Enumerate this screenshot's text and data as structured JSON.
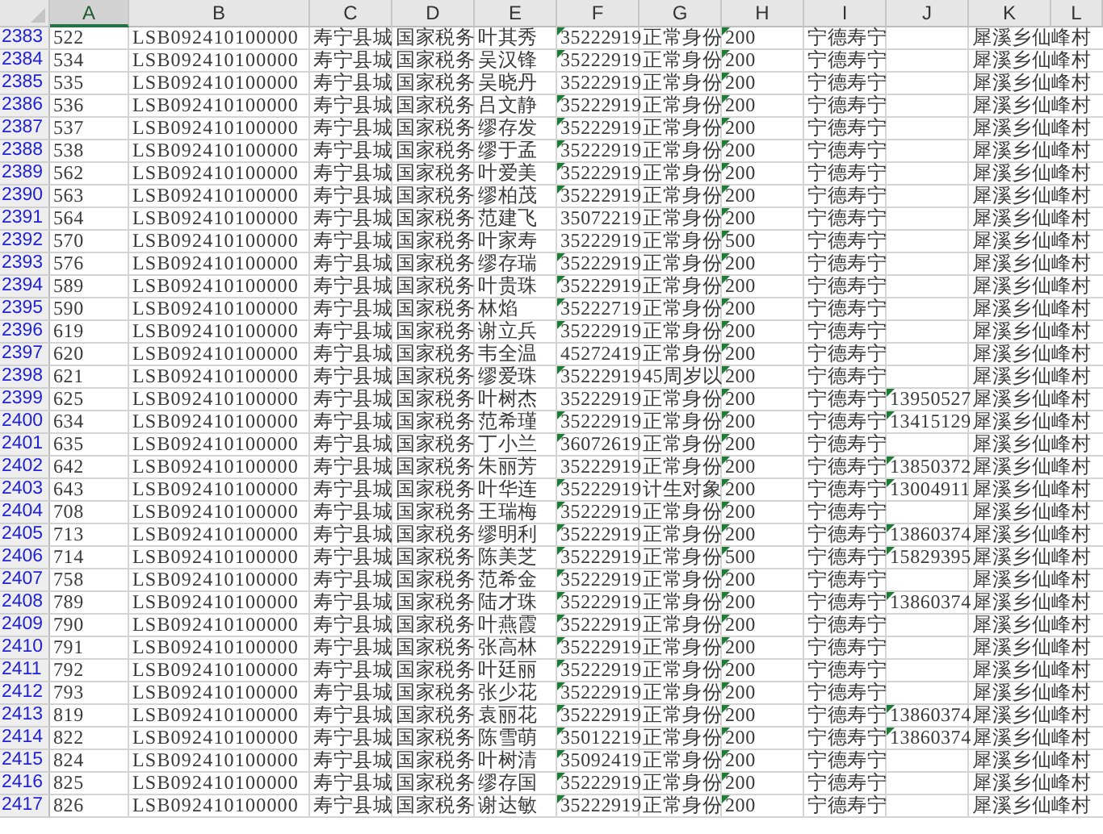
{
  "columns": [
    {
      "label": "A",
      "selected": true
    },
    {
      "label": "B",
      "selected": false
    },
    {
      "label": "C",
      "selected": false
    },
    {
      "label": "D",
      "selected": false
    },
    {
      "label": "E",
      "selected": false
    },
    {
      "label": "F",
      "selected": false
    },
    {
      "label": "G",
      "selected": false
    },
    {
      "label": "H",
      "selected": false
    },
    {
      "label": "I",
      "selected": false
    },
    {
      "label": "J",
      "selected": false
    },
    {
      "label": "K",
      "selected": false
    },
    {
      "label": "L",
      "selected": false
    }
  ],
  "rows": [
    {
      "row": "2383",
      "cells": [
        "522",
        "LSB092410100000",
        "寿宁县城",
        "国家税务",
        "叶其秀",
        "35222919",
        "正常身份",
        "200",
        "宁德寿宁",
        null,
        "犀溪乡仙峰村"
      ],
      "errors": [
        false,
        false,
        false,
        false,
        false,
        true,
        false,
        true,
        false,
        false,
        false
      ]
    },
    {
      "row": "2384",
      "cells": [
        "534",
        "LSB092410100000",
        "寿宁县城",
        "国家税务",
        "吴汉锋",
        "35222919",
        "正常身份",
        "200",
        "宁德寿宁",
        null,
        "犀溪乡仙峰村"
      ],
      "errors": [
        false,
        false,
        false,
        false,
        false,
        true,
        false,
        true,
        false,
        false,
        false
      ]
    },
    {
      "row": "2385",
      "cells": [
        "535",
        "LSB092410100000",
        "寿宁县城",
        "国家税务",
        "吴晓丹",
        "35222919",
        "正常身份",
        "200",
        "宁德寿宁",
        null,
        "犀溪乡仙峰村"
      ],
      "errors": [
        false,
        false,
        false,
        false,
        false,
        false,
        false,
        true,
        false,
        false,
        false
      ]
    },
    {
      "row": "2386",
      "cells": [
        "536",
        "LSB092410100000",
        "寿宁县城",
        "国家税务",
        "吕文静",
        "35222919",
        "正常身份",
        "200",
        "宁德寿宁",
        null,
        "犀溪乡仙峰村"
      ],
      "errors": [
        false,
        false,
        false,
        false,
        false,
        true,
        false,
        true,
        false,
        false,
        false
      ]
    },
    {
      "row": "2387",
      "cells": [
        "537",
        "LSB092410100000",
        "寿宁县城",
        "国家税务",
        "缪存发",
        "35222919",
        "正常身份",
        "200",
        "宁德寿宁",
        null,
        "犀溪乡仙峰村"
      ],
      "errors": [
        false,
        false,
        false,
        false,
        false,
        true,
        false,
        true,
        false,
        false,
        false
      ]
    },
    {
      "row": "2388",
      "cells": [
        "538",
        "LSB092410100000",
        "寿宁县城",
        "国家税务",
        "缪于孟",
        "35222919",
        "正常身份",
        "200",
        "宁德寿宁",
        null,
        "犀溪乡仙峰村"
      ],
      "errors": [
        false,
        false,
        false,
        false,
        false,
        true,
        false,
        true,
        false,
        false,
        false
      ]
    },
    {
      "row": "2389",
      "cells": [
        "562",
        "LSB092410100000",
        "寿宁县城",
        "国家税务",
        "叶爱美",
        "35222919",
        "正常身份",
        "200",
        "宁德寿宁",
        null,
        "犀溪乡仙峰村"
      ],
      "errors": [
        false,
        false,
        false,
        false,
        false,
        true,
        false,
        true,
        false,
        false,
        false
      ]
    },
    {
      "row": "2390",
      "cells": [
        "563",
        "LSB092410100000",
        "寿宁县城",
        "国家税务",
        "缪柏茂",
        "35222919",
        "正常身份",
        "200",
        "宁德寿宁",
        null,
        "犀溪乡仙峰村"
      ],
      "errors": [
        false,
        false,
        false,
        false,
        false,
        true,
        false,
        true,
        false,
        false,
        false
      ]
    },
    {
      "row": "2391",
      "cells": [
        "564",
        "LSB092410100000",
        "寿宁县城",
        "国家税务",
        "范建飞",
        "35072219",
        "正常身份",
        "200",
        "宁德寿宁",
        null,
        "犀溪乡仙峰村"
      ],
      "errors": [
        false,
        false,
        false,
        false,
        false,
        false,
        false,
        true,
        false,
        false,
        false
      ]
    },
    {
      "row": "2392",
      "cells": [
        "570",
        "LSB092410100000",
        "寿宁县城",
        "国家税务",
        "叶家寿",
        "35222919",
        "正常身份",
        "500",
        "宁德寿宁",
        null,
        "犀溪乡仙峰村"
      ],
      "errors": [
        false,
        false,
        false,
        false,
        false,
        false,
        false,
        true,
        false,
        false,
        false
      ]
    },
    {
      "row": "2393",
      "cells": [
        "576",
        "LSB092410100000",
        "寿宁县城",
        "国家税务",
        "缪存瑞",
        "35222919",
        "正常身份",
        "200",
        "宁德寿宁",
        null,
        "犀溪乡仙峰村"
      ],
      "errors": [
        false,
        false,
        false,
        false,
        false,
        true,
        false,
        true,
        false,
        false,
        false
      ]
    },
    {
      "row": "2394",
      "cells": [
        "589",
        "LSB092410100000",
        "寿宁县城",
        "国家税务",
        "叶贵珠",
        "35222919",
        "正常身份",
        "200",
        "宁德寿宁",
        null,
        "犀溪乡仙峰村"
      ],
      "errors": [
        false,
        false,
        false,
        false,
        false,
        true,
        false,
        true,
        false,
        false,
        false
      ]
    },
    {
      "row": "2395",
      "cells": [
        "590",
        "LSB092410100000",
        "寿宁县城",
        "国家税务",
        "林焰",
        "35222719",
        "正常身份",
        "200",
        "宁德寿宁",
        null,
        "犀溪乡仙峰村"
      ],
      "errors": [
        false,
        false,
        false,
        false,
        false,
        true,
        false,
        true,
        false,
        false,
        false
      ]
    },
    {
      "row": "2396",
      "cells": [
        "619",
        "LSB092410100000",
        "寿宁县城",
        "国家税务",
        "谢立兵",
        "35222919",
        "正常身份",
        "200",
        "宁德寿宁",
        null,
        "犀溪乡仙峰村"
      ],
      "errors": [
        false,
        false,
        false,
        false,
        false,
        true,
        false,
        true,
        false,
        false,
        false
      ]
    },
    {
      "row": "2397",
      "cells": [
        "620",
        "LSB092410100000",
        "寿宁县城",
        "国家税务",
        "韦全温",
        "45272419",
        "正常身份",
        "200",
        "宁德寿宁",
        null,
        "犀溪乡仙峰村"
      ],
      "errors": [
        false,
        false,
        false,
        false,
        false,
        false,
        false,
        true,
        false,
        false,
        false
      ]
    },
    {
      "row": "2398",
      "cells": [
        "621",
        "LSB092410100000",
        "寿宁县城",
        "国家税务",
        "缪爱珠",
        "35222919",
        "45周岁以",
        "200",
        "宁德寿宁",
        null,
        "犀溪乡仙峰村"
      ],
      "errors": [
        false,
        false,
        false,
        false,
        false,
        true,
        false,
        true,
        false,
        false,
        false
      ]
    },
    {
      "row": "2399",
      "cells": [
        "625",
        "LSB092410100000",
        "寿宁县城",
        "国家税务",
        "叶树杰",
        "35222919",
        "正常身份",
        "200",
        "宁德寿宁",
        "13950527",
        "犀溪乡仙峰村"
      ],
      "errors": [
        false,
        false,
        false,
        false,
        false,
        false,
        false,
        true,
        false,
        true,
        false
      ]
    },
    {
      "row": "2400",
      "cells": [
        "634",
        "LSB092410100000",
        "寿宁县城",
        "国家税务",
        "范希瑾",
        "35222919",
        "正常身份",
        "200",
        "宁德寿宁",
        "13415129",
        "犀溪乡仙峰村"
      ],
      "errors": [
        false,
        false,
        false,
        false,
        false,
        true,
        false,
        true,
        false,
        true,
        false
      ]
    },
    {
      "row": "2401",
      "cells": [
        "635",
        "LSB092410100000",
        "寿宁县城",
        "国家税务",
        "丁小兰",
        "36072619",
        "正常身份",
        "200",
        "宁德寿宁",
        null,
        "犀溪乡仙峰村"
      ],
      "errors": [
        false,
        false,
        false,
        false,
        false,
        true,
        false,
        true,
        false,
        false,
        false
      ]
    },
    {
      "row": "2402",
      "cells": [
        "642",
        "LSB092410100000",
        "寿宁县城",
        "国家税务",
        "朱丽芳",
        "35222919",
        "正常身份",
        "200",
        "宁德寿宁",
        "13850372",
        "犀溪乡仙峰村"
      ],
      "errors": [
        false,
        false,
        false,
        false,
        false,
        false,
        false,
        true,
        false,
        true,
        false
      ]
    },
    {
      "row": "2403",
      "cells": [
        "643",
        "LSB092410100000",
        "寿宁县城",
        "国家税务",
        "叶华连",
        "35222919",
        "计生对象",
        "200",
        "宁德寿宁",
        "13004911",
        "犀溪乡仙峰村"
      ],
      "errors": [
        false,
        false,
        false,
        false,
        false,
        true,
        false,
        true,
        false,
        true,
        false
      ]
    },
    {
      "row": "2404",
      "cells": [
        "708",
        "LSB092410100000",
        "寿宁县城",
        "国家税务",
        "王瑞梅",
        "35222919",
        "正常身份",
        "200",
        "宁德寿宁",
        null,
        "犀溪乡仙峰村"
      ],
      "errors": [
        false,
        false,
        false,
        false,
        false,
        true,
        false,
        true,
        false,
        false,
        false
      ]
    },
    {
      "row": "2405",
      "cells": [
        "713",
        "LSB092410100000",
        "寿宁县城",
        "国家税务",
        "缪明利",
        "35222919",
        "正常身份",
        "200",
        "宁德寿宁",
        "13860374",
        "犀溪乡仙峰村"
      ],
      "errors": [
        false,
        false,
        false,
        false,
        false,
        true,
        false,
        true,
        false,
        true,
        false
      ]
    },
    {
      "row": "2406",
      "cells": [
        "714",
        "LSB092410100000",
        "寿宁县城",
        "国家税务",
        "陈美芝",
        "35222919",
        "正常身份",
        "500",
        "宁德寿宁",
        "15829395",
        "犀溪乡仙峰村"
      ],
      "errors": [
        false,
        false,
        false,
        false,
        false,
        true,
        false,
        true,
        false,
        true,
        false
      ]
    },
    {
      "row": "2407",
      "cells": [
        "758",
        "LSB092410100000",
        "寿宁县城",
        "国家税务",
        "范希金",
        "35222919",
        "正常身份",
        "200",
        "宁德寿宁",
        null,
        "犀溪乡仙峰村"
      ],
      "errors": [
        false,
        false,
        false,
        false,
        false,
        true,
        false,
        true,
        false,
        false,
        false
      ]
    },
    {
      "row": "2408",
      "cells": [
        "789",
        "LSB092410100000",
        "寿宁县城",
        "国家税务",
        "陆才珠",
        "35222919",
        "正常身份",
        "200",
        "宁德寿宁",
        "13860374",
        "犀溪乡仙峰村"
      ],
      "errors": [
        false,
        false,
        false,
        false,
        false,
        true,
        false,
        true,
        false,
        true,
        false
      ]
    },
    {
      "row": "2409",
      "cells": [
        "790",
        "LSB092410100000",
        "寿宁县城",
        "国家税务",
        "叶燕霞",
        "35222919",
        "正常身份",
        "200",
        "宁德寿宁",
        null,
        "犀溪乡仙峰村"
      ],
      "errors": [
        false,
        false,
        false,
        false,
        false,
        true,
        false,
        true,
        false,
        false,
        false
      ]
    },
    {
      "row": "2410",
      "cells": [
        "791",
        "LSB092410100000",
        "寿宁县城",
        "国家税务",
        "张高林",
        "35222919",
        "正常身份",
        "200",
        "宁德寿宁",
        null,
        "犀溪乡仙峰村"
      ],
      "errors": [
        false,
        false,
        false,
        false,
        false,
        true,
        false,
        true,
        false,
        false,
        false
      ]
    },
    {
      "row": "2411",
      "cells": [
        "792",
        "LSB092410100000",
        "寿宁县城",
        "国家税务",
        "叶廷丽",
        "35222919",
        "正常身份",
        "200",
        "宁德寿宁",
        null,
        "犀溪乡仙峰村"
      ],
      "errors": [
        false,
        false,
        false,
        false,
        false,
        true,
        false,
        true,
        false,
        false,
        false
      ]
    },
    {
      "row": "2412",
      "cells": [
        "793",
        "LSB092410100000",
        "寿宁县城",
        "国家税务",
        "张少花",
        "35222919",
        "正常身份",
        "200",
        "宁德寿宁",
        null,
        "犀溪乡仙峰村"
      ],
      "errors": [
        false,
        false,
        false,
        false,
        false,
        true,
        false,
        true,
        false,
        false,
        false
      ]
    },
    {
      "row": "2413",
      "cells": [
        "819",
        "LSB092410100000",
        "寿宁县城",
        "国家税务",
        "袁丽花",
        "35222919",
        "正常身份",
        "200",
        "宁德寿宁",
        "13860374",
        "犀溪乡仙峰村"
      ],
      "errors": [
        false,
        false,
        false,
        false,
        false,
        true,
        false,
        true,
        false,
        true,
        false
      ]
    },
    {
      "row": "2414",
      "cells": [
        "822",
        "LSB092410100000",
        "寿宁县城",
        "国家税务",
        "陈雪萌",
        "35012219",
        "正常身份",
        "200",
        "宁德寿宁",
        "13860374",
        "犀溪乡仙峰村"
      ],
      "errors": [
        false,
        false,
        false,
        false,
        false,
        true,
        false,
        true,
        false,
        true,
        false
      ]
    },
    {
      "row": "2415",
      "cells": [
        "824",
        "LSB092410100000",
        "寿宁县城",
        "国家税务",
        "叶树清",
        "35092419",
        "正常身份",
        "200",
        "宁德寿宁",
        null,
        "犀溪乡仙峰村"
      ],
      "errors": [
        false,
        false,
        false,
        false,
        false,
        true,
        false,
        true,
        false,
        false,
        false
      ]
    },
    {
      "row": "2416",
      "cells": [
        "825",
        "LSB092410100000",
        "寿宁县城",
        "国家税务",
        "缪存国",
        "35222919",
        "正常身份",
        "200",
        "宁德寿宁",
        null,
        "犀溪乡仙峰村"
      ],
      "errors": [
        false,
        false,
        false,
        false,
        false,
        true,
        false,
        true,
        false,
        false,
        false
      ]
    },
    {
      "row": "2417",
      "cells": [
        "826",
        "LSB092410100000",
        "寿宁县城",
        "国家税务",
        "谢达敏",
        "35222919",
        "正常身份",
        "200",
        "宁德寿宁",
        null,
        "犀溪乡仙峰村"
      ],
      "errors": [
        false,
        false,
        false,
        false,
        false,
        true,
        false,
        true,
        false,
        false,
        false
      ]
    }
  ]
}
